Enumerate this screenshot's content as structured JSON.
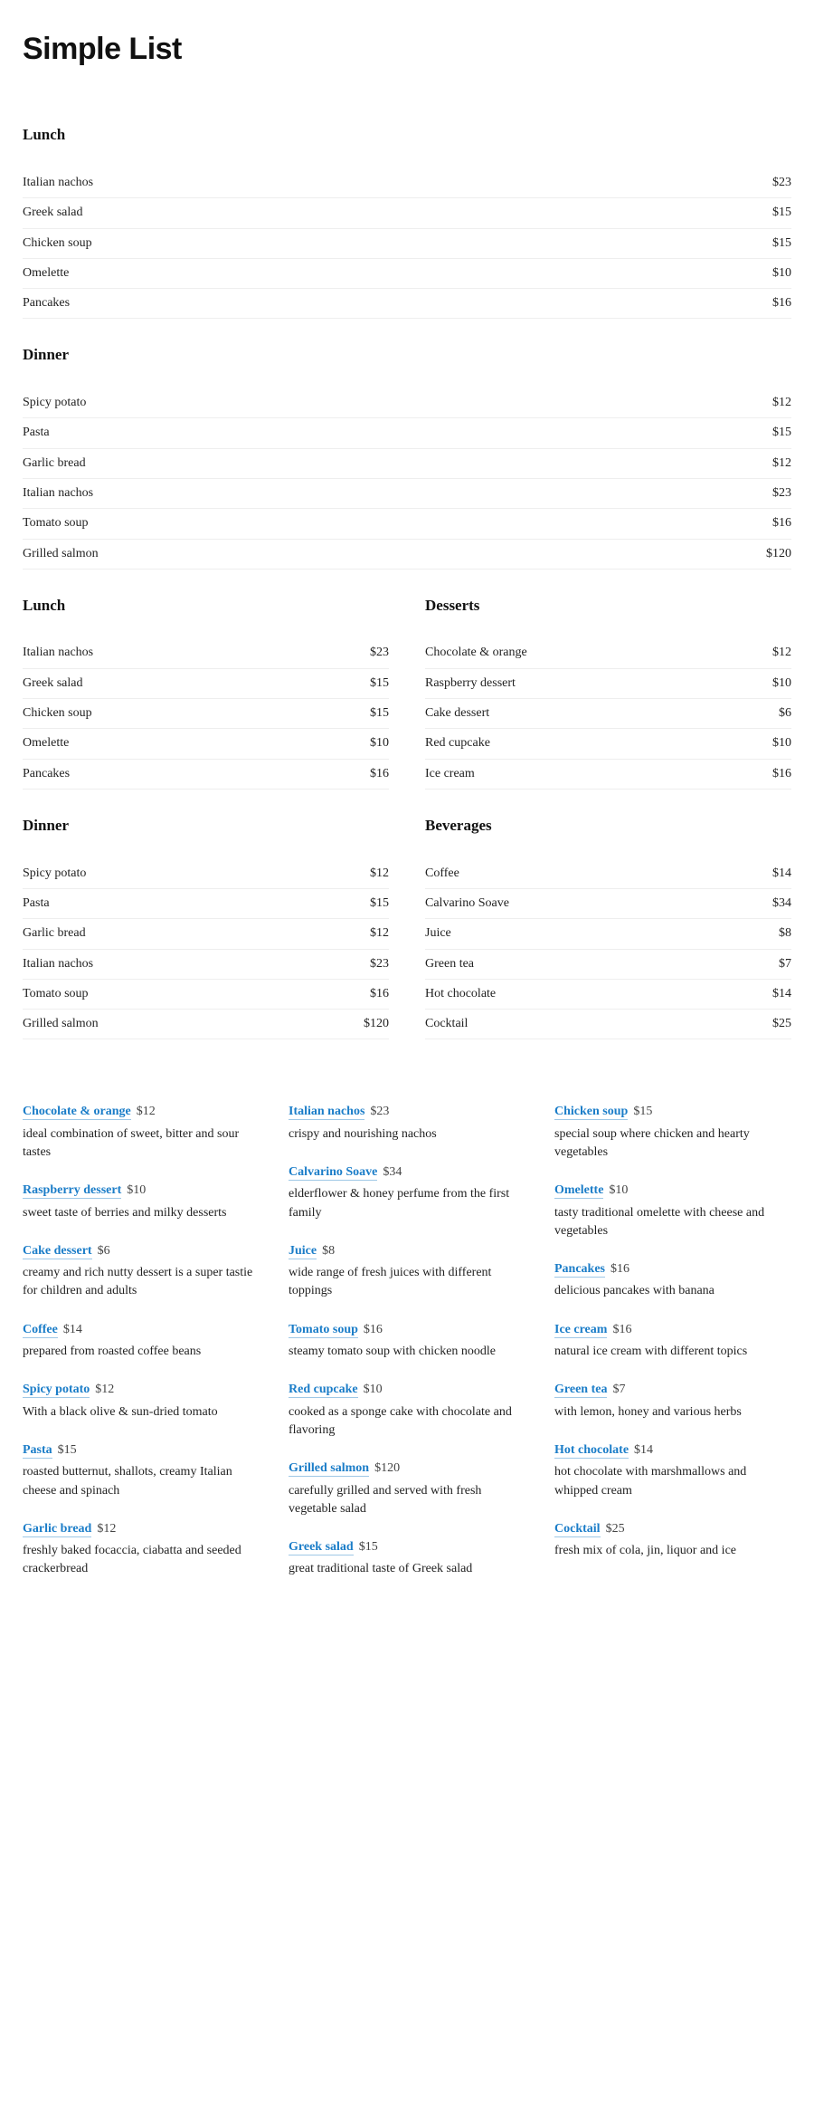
{
  "page_title": "Simple List",
  "full_width_sections": [
    {
      "title": "Lunch",
      "items": [
        {
          "name": "Italian nachos",
          "price": "$23"
        },
        {
          "name": "Greek salad",
          "price": "$15"
        },
        {
          "name": "Chicken soup",
          "price": "$15"
        },
        {
          "name": "Omelette",
          "price": "$10"
        },
        {
          "name": "Pancakes",
          "price": "$16"
        }
      ]
    },
    {
      "title": "Dinner",
      "items": [
        {
          "name": "Spicy potato",
          "price": "$12"
        },
        {
          "name": "Pasta",
          "price": "$15"
        },
        {
          "name": "Garlic bread",
          "price": "$12"
        },
        {
          "name": "Italian nachos",
          "price": "$23"
        },
        {
          "name": "Tomato soup",
          "price": "$16"
        },
        {
          "name": "Grilled salmon",
          "price": "$120"
        }
      ]
    }
  ],
  "two_col_left": [
    {
      "title": "Lunch",
      "items": [
        {
          "name": "Italian nachos",
          "price": "$23"
        },
        {
          "name": "Greek salad",
          "price": "$15"
        },
        {
          "name": "Chicken soup",
          "price": "$15"
        },
        {
          "name": "Omelette",
          "price": "$10"
        },
        {
          "name": "Pancakes",
          "price": "$16"
        }
      ]
    },
    {
      "title": "Dinner",
      "items": [
        {
          "name": "Spicy potato",
          "price": "$12"
        },
        {
          "name": "Pasta",
          "price": "$15"
        },
        {
          "name": "Garlic bread",
          "price": "$12"
        },
        {
          "name": "Italian nachos",
          "price": "$23"
        },
        {
          "name": "Tomato soup",
          "price": "$16"
        },
        {
          "name": "Grilled salmon",
          "price": "$120"
        }
      ]
    }
  ],
  "two_col_right": [
    {
      "title": "Desserts",
      "items": [
        {
          "name": "Chocolate & orange",
          "price": "$12"
        },
        {
          "name": "Raspberry dessert",
          "price": "$10"
        },
        {
          "name": "Cake dessert",
          "price": "$6"
        },
        {
          "name": "Red cupcake",
          "price": "$10"
        },
        {
          "name": "Ice cream",
          "price": "$16"
        }
      ]
    },
    {
      "title": "Beverages",
      "items": [
        {
          "name": "Coffee",
          "price": "$14"
        },
        {
          "name": "Calvarino Soave",
          "price": "$34"
        },
        {
          "name": "Juice",
          "price": "$8"
        },
        {
          "name": "Green tea",
          "price": "$7"
        },
        {
          "name": "Hot chocolate",
          "price": "$14"
        },
        {
          "name": "Cocktail",
          "price": "$25"
        }
      ]
    }
  ],
  "desc_col_1": [
    {
      "name": "Chocolate & orange",
      "price": "$12",
      "desc": "ideal combination of sweet, bitter and sour tastes"
    },
    {
      "name": "Raspberry dessert",
      "price": "$10",
      "desc": "sweet taste of berries and milky desserts"
    },
    {
      "name": "Cake dessert",
      "price": "$6",
      "desc": "creamy and rich nutty dessert is a super tastie for children and adults"
    },
    {
      "name": "Coffee",
      "price": "$14",
      "desc": "prepared from roasted coffee beans"
    },
    {
      "name": "Spicy potato",
      "price": "$12",
      "desc": "With a black olive & sun-dried tomato"
    },
    {
      "name": "Pasta",
      "price": "$15",
      "desc": "roasted butternut, shallots, creamy Italian cheese and spinach"
    },
    {
      "name": "Garlic bread",
      "price": "$12",
      "desc": "freshly baked focaccia, ciabatta and seeded crackerbread"
    }
  ],
  "desc_col_2": [
    {
      "name": "Italian nachos",
      "price": "$23",
      "desc": "crispy and nourishing nachos"
    },
    {
      "name": "Calvarino Soave",
      "price": "$34",
      "desc": "elderflower & honey perfume from the first family"
    },
    {
      "name": "Juice",
      "price": "$8",
      "desc": "wide range of fresh juices with different toppings"
    },
    {
      "name": "Tomato soup",
      "price": "$16",
      "desc": "steamy tomato soup with chicken noodle"
    },
    {
      "name": "Red cupcake",
      "price": "$10",
      "desc": "cooked as a sponge cake with chocolate and flavoring"
    },
    {
      "name": "Grilled salmon",
      "price": "$120",
      "desc": "carefully grilled and served with fresh vegetable salad"
    },
    {
      "name": "Greek salad",
      "price": "$15",
      "desc": "great traditional taste of Greek salad"
    }
  ],
  "desc_col_3": [
    {
      "name": "Chicken soup",
      "price": "$15",
      "desc": "special soup where chicken and hearty vegetables"
    },
    {
      "name": "Omelette",
      "price": "$10",
      "desc": "tasty traditional omelette with cheese and vegetables"
    },
    {
      "name": "Pancakes",
      "price": "$16",
      "desc": "delicious pancakes with banana"
    },
    {
      "name": "Ice cream",
      "price": "$16",
      "desc": "natural ice cream with different topics"
    },
    {
      "name": "Green tea",
      "price": "$7",
      "desc": "with lemon, honey and various herbs"
    },
    {
      "name": "Hot chocolate",
      "price": "$14",
      "desc": "hot chocolate with marshmallows and whipped cream"
    },
    {
      "name": "Cocktail",
      "price": "$25",
      "desc": "fresh mix of cola, jin, liquor and ice"
    }
  ]
}
